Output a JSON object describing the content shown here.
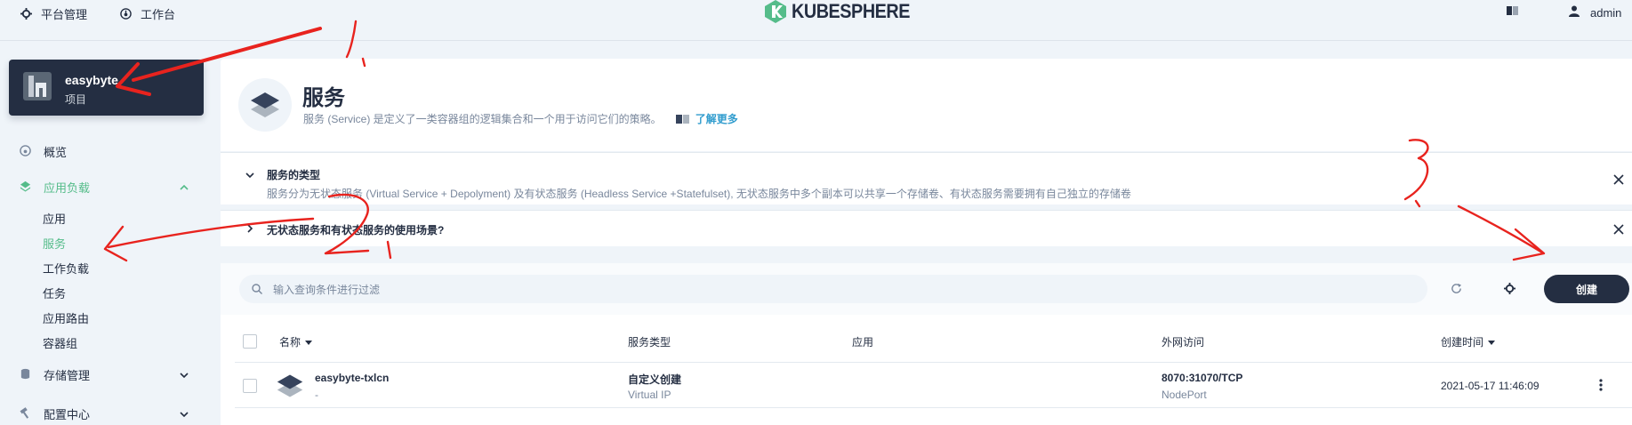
{
  "topbar": {
    "platform_label": "平台管理",
    "workbench_label": "工作台",
    "logo_text": "KUBESPHERE",
    "user_name": "admin"
  },
  "sidebar": {
    "project_name": "easybyte",
    "project_type": "项目",
    "items": [
      {
        "label": "概览",
        "icon": "dashboard-icon"
      },
      {
        "label": "应用负载",
        "icon": "layers-icon",
        "expanded": true
      },
      {
        "label": "存储管理",
        "icon": "database-icon"
      },
      {
        "label": "配置中心",
        "icon": "hammer-icon"
      }
    ],
    "sub_items": [
      "应用",
      "服务",
      "工作负载",
      "任务",
      "应用路由",
      "容器组"
    ],
    "active_sub": "服务"
  },
  "banner": {
    "title": "服务",
    "description": "服务 (Service) 是定义了一类容器组的逻辑集合和一个用于访问它们的策略。",
    "learn_more": "了解更多"
  },
  "tips": [
    {
      "title": "服务的类型",
      "body": "服务分为无状态服务 (Virtual Service + Depolyment) 及有状态服务 (Headless Service +Statefulset), 无状态服务中多个副本可以共享一个存储卷、有状态服务需要拥有自己独立的存储卷",
      "expanded": true
    },
    {
      "title": "无状态服务和有状态服务的使用场景?",
      "expanded": false
    }
  ],
  "toolbar": {
    "search_placeholder": "输入查询条件进行过滤",
    "create_label": "创建"
  },
  "table": {
    "headers": {
      "name": "名称",
      "service_type": "服务类型",
      "app": "应用",
      "external": "外网访问",
      "created": "创建时间"
    },
    "rows": [
      {
        "name": "easybyte-txlcn",
        "name_sub": "-",
        "type": "自定义创建",
        "type_sub": "Virtual IP",
        "app": "",
        "external": "8070:31070/TCP",
        "external_sub": "NodePort",
        "created": "2021-05-17 11:46:09"
      }
    ]
  },
  "annotations": {
    "labels": [
      "1.",
      "2",
      "3"
    ],
    "color": "#e8231e"
  },
  "colors": {
    "accent_green": "#55bc8a",
    "dark": "#242e42",
    "link_blue": "#329dce"
  }
}
